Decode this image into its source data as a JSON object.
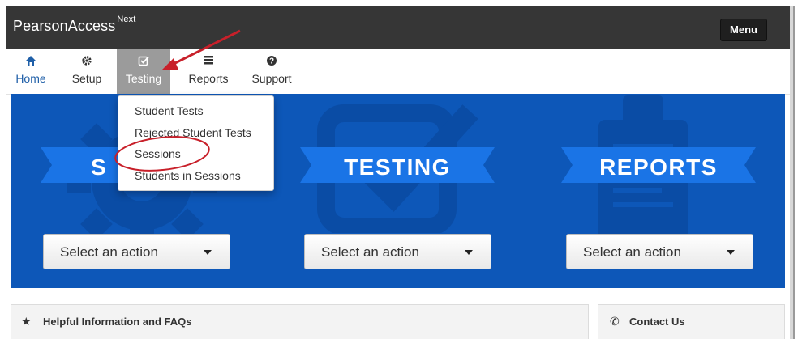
{
  "header": {
    "brand": "PearsonAccess",
    "brand_sup": "Next",
    "menu_label": "Menu"
  },
  "nav": {
    "items": [
      {
        "label": "Home",
        "icon": "home-icon"
      },
      {
        "label": "Setup",
        "icon": "gear-icon"
      },
      {
        "label": "Testing",
        "icon": "check-square-icon"
      },
      {
        "label": "Reports",
        "icon": "list-icon"
      },
      {
        "label": "Support",
        "icon": "question-circle-icon"
      }
    ],
    "active": "Testing"
  },
  "dropdown": {
    "items": [
      "Student Tests",
      "Rejected Student Tests",
      "Sessions",
      "Students in Sessions"
    ],
    "highlighted": "Sessions"
  },
  "banner": {
    "sections": [
      {
        "title": "SETUP",
        "visible_title": "S",
        "action": "Select an action",
        "icon": "gear-icon"
      },
      {
        "title": "TESTING",
        "visible_title": "TESTING",
        "action": "Select an action",
        "icon": "check-square-icon"
      },
      {
        "title": "REPORTS",
        "visible_title": "REPORTS",
        "action": "Select an action",
        "icon": "clipboard-icon"
      }
    ]
  },
  "panels": {
    "left_title": "Helpful Information and FAQs",
    "left_icon": "star-icon",
    "right_title": "Contact Us",
    "right_icon": "phone-icon"
  },
  "colors": {
    "header_bg": "#363636",
    "banner_bg": "#0d57b8",
    "ribbon": "#1a74e6",
    "active_tab": "#9b9b9b",
    "annotation": "#c8202a",
    "link": "#1f5fa8"
  }
}
